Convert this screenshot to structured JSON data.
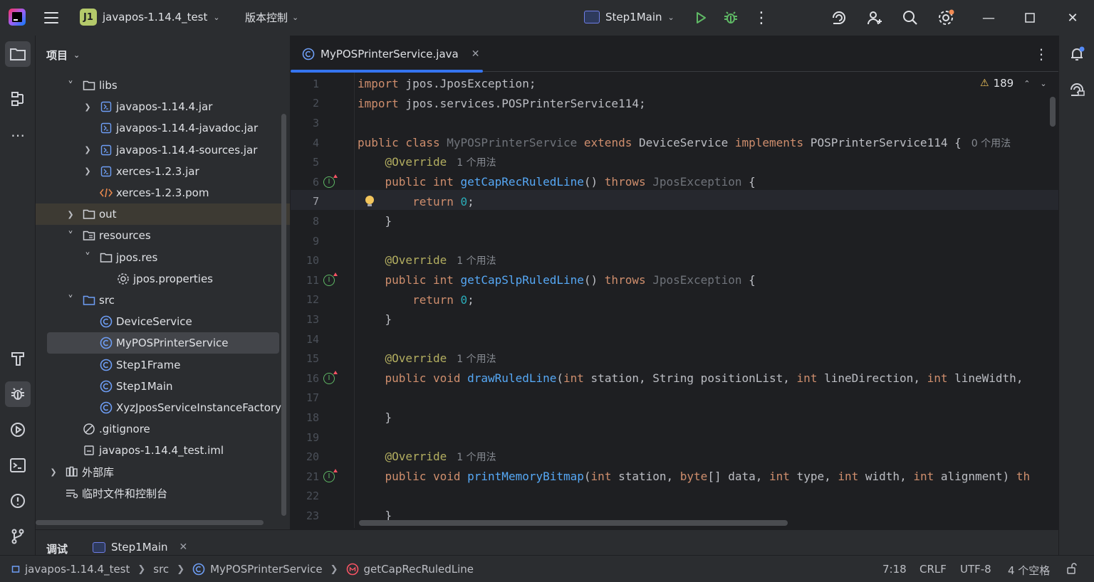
{
  "title_bar": {
    "project_badge": "J1",
    "project_name": "javapos-1.14.4_test",
    "vcs_label": "版本控制",
    "run_config": "Step1Main"
  },
  "project_panel": {
    "header": "项目",
    "tree": [
      {
        "label": "libs",
        "icon": "folder-icon",
        "depth": 1,
        "arrow": "expanded"
      },
      {
        "label": "javapos-1.14.4.jar",
        "icon": "jar-icon",
        "depth": 2,
        "arrow": "collapsed"
      },
      {
        "label": "javapos-1.14.4-javadoc.jar",
        "icon": "jar-icon",
        "depth": 2,
        "arrow": "none"
      },
      {
        "label": "javapos-1.14.4-sources.jar",
        "icon": "jar-icon",
        "depth": 2,
        "arrow": "collapsed"
      },
      {
        "label": "xerces-1.2.3.jar",
        "icon": "jar-icon",
        "depth": 2,
        "arrow": "collapsed"
      },
      {
        "label": "xerces-1.2.3.pom",
        "icon": "xml-icon",
        "depth": 2,
        "arrow": "none"
      },
      {
        "label": "out",
        "icon": "folder-icon",
        "depth": 1,
        "arrow": "collapsed",
        "highlight": true
      },
      {
        "label": "resources",
        "icon": "resources-folder-icon",
        "depth": 1,
        "arrow": "expanded"
      },
      {
        "label": "jpos.res",
        "icon": "folder-icon",
        "depth": 2,
        "arrow": "expanded"
      },
      {
        "label": "jpos.properties",
        "icon": "properties-icon",
        "depth": 3,
        "arrow": "none"
      },
      {
        "label": "src",
        "icon": "source-folder-icon",
        "depth": 1,
        "arrow": "expanded"
      },
      {
        "label": "DeviceService",
        "icon": "class-icon",
        "depth": 2,
        "arrow": "none"
      },
      {
        "label": "MyPOSPrinterService",
        "icon": "class-icon",
        "depth": 2,
        "arrow": "none",
        "selected": true
      },
      {
        "label": "Step1Frame",
        "icon": "class-icon",
        "depth": 2,
        "arrow": "none"
      },
      {
        "label": "Step1Main",
        "icon": "class-icon",
        "depth": 2,
        "arrow": "none"
      },
      {
        "label": "XyzJposServiceInstanceFactory",
        "icon": "class-icon",
        "depth": 2,
        "arrow": "none"
      },
      {
        "label": ".gitignore",
        "icon": "ignore-icon",
        "depth": 1,
        "arrow": "none"
      },
      {
        "label": "javapos-1.14.4_test.iml",
        "icon": "module-icon",
        "depth": 1,
        "arrow": "none"
      },
      {
        "label": "外部库",
        "icon": "library-icon",
        "depth": 0,
        "arrow": "collapsed"
      },
      {
        "label": "临时文件和控制台",
        "icon": "scratch-icon",
        "depth": 0,
        "arrow": "none"
      }
    ]
  },
  "editor": {
    "tab_name": "MyPOSPrinterService.java",
    "warning_count": "189",
    "current_line": 7,
    "lines": [
      {
        "n": "1",
        "html": "<span class='kw'>import</span> jpos.JposException;"
      },
      {
        "n": "2",
        "html": "<span class='kw'>import</span> jpos.services.POSPrinterService114;"
      },
      {
        "n": "3",
        "html": ""
      },
      {
        "n": "4",
        "html": "<span class='kw'>public class</span> <span class='gray'>MyPOSPrinterService</span> <span class='kw'>extends</span> DeviceService <span class='kw'>implements</span> POSPrinterService114 {",
        "hint": "0 个用法"
      },
      {
        "n": "5",
        "html": "    <span class='an'>@Override</span>",
        "hint": "1 个用法"
      },
      {
        "n": "6",
        "html": "    <span class='kw'>public int</span> <span class='fn'>getCapRecRuledLine</span>() <span class='kw'>throws</span> <span class='gray'>JposException</span> {",
        "mark": true
      },
      {
        "n": "7",
        "html": "        <span class='kw'>return</span> <span class='num'>0</span>;",
        "bulb": true
      },
      {
        "n": "8",
        "html": "    }"
      },
      {
        "n": "9",
        "html": ""
      },
      {
        "n": "10",
        "html": "    <span class='an'>@Override</span>",
        "hint": "1 个用法"
      },
      {
        "n": "11",
        "html": "    <span class='kw'>public int</span> <span class='fn'>getCapSlpRuledLine</span>() <span class='kw'>throws</span> <span class='gray'>JposException</span> {",
        "mark": true
      },
      {
        "n": "12",
        "html": "        <span class='kw'>return</span> <span class='num'>0</span>;"
      },
      {
        "n": "13",
        "html": "    }"
      },
      {
        "n": "14",
        "html": ""
      },
      {
        "n": "15",
        "html": "    <span class='an'>@Override</span>",
        "hint": "1 个用法"
      },
      {
        "n": "16",
        "html": "    <span class='kw'>public void</span> <span class='fn'>drawRuledLine</span>(<span class='kw'>int</span> station, String positionList, <span class='kw'>int</span> lineDirection, <span class='kw'>int</span> lineWidth,",
        "mark": true
      },
      {
        "n": "17",
        "html": ""
      },
      {
        "n": "18",
        "html": "    }"
      },
      {
        "n": "19",
        "html": ""
      },
      {
        "n": "20",
        "html": "    <span class='an'>@Override</span>",
        "hint": "1 个用法"
      },
      {
        "n": "21",
        "html": "    <span class='kw'>public void</span> <span class='fn'>printMemoryBitmap</span>(<span class='kw'>int</span> station, <span class='kw'>byte</span>[] data, <span class='kw'>int</span> type, <span class='kw'>int</span> width, <span class='kw'>int</span> alignment) <span class='kw'>th</span>",
        "mark": true
      },
      {
        "n": "22",
        "html": ""
      },
      {
        "n": "23",
        "html": "    }"
      }
    ]
  },
  "bottom_panel": {
    "label": "调试",
    "tab": "Step1Main"
  },
  "status_bar": {
    "crumbs": [
      "javapos-1.14.4_test",
      "src",
      "MyPOSPrinterService",
      "getCapRecRuledLine"
    ],
    "position": "7:18",
    "line_sep": "CRLF",
    "encoding": "UTF-8",
    "indent": "4 个空格"
  },
  "colors": {
    "accent": "#3574f0",
    "keyword": "#cf8e6d",
    "annotation": "#b3ae60",
    "function": "#56a8f5",
    "number": "#2aacb8",
    "run_green": "#5fb865"
  }
}
